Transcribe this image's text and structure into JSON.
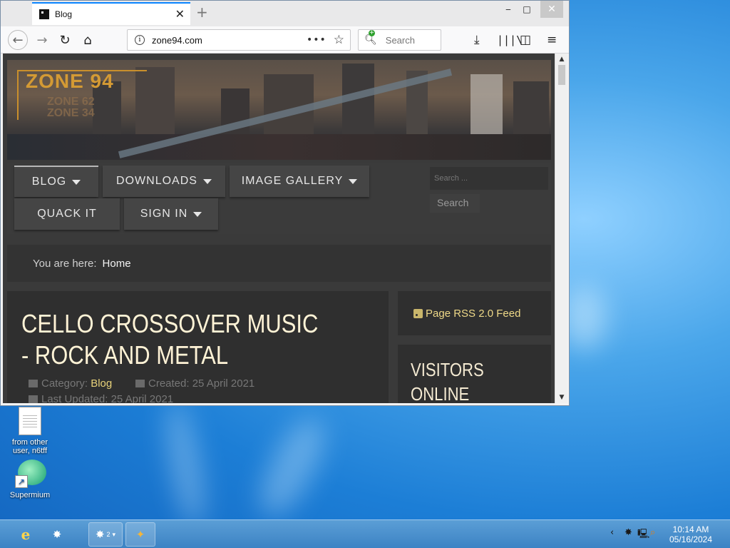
{
  "browser": {
    "tab_title": "Blog",
    "new_tab_icon": "plus",
    "url": "zone94.com",
    "search_placeholder": "Search"
  },
  "site": {
    "logo_main": "ZONE 94",
    "logo_sub1": "ZONE 62",
    "logo_sub2": "ZONE 34",
    "menu": {
      "blog": "BLOG",
      "downloads": "DOWNLOADS",
      "image_gallery": "IMAGE GALLERY",
      "quack_it": "QUACK IT",
      "sign_in": "SIGN IN"
    },
    "search_placeholder": "Search ...",
    "search_button": "Search",
    "breadcrumb_label": "You are here:",
    "breadcrumb_home": "Home",
    "article": {
      "title": "CELLO CROSSOVER MUSIC - ROCK AND METAL",
      "category_label": "Category:",
      "category_value": "Blog",
      "created": "Created: 25 April 2021",
      "updated": "Last Updated: 25 April 2021"
    },
    "rss_label": "Page RSS 2.0 Feed",
    "visitors_title": "VISITORS ONLINE"
  },
  "desktop": {
    "icon1_label": "from other user, n6tff",
    "icon2_label": "Supermium"
  },
  "taskbar": {
    "group_count": "2",
    "clock_time": "10:14 AM",
    "clock_date": "05/16/2024"
  }
}
